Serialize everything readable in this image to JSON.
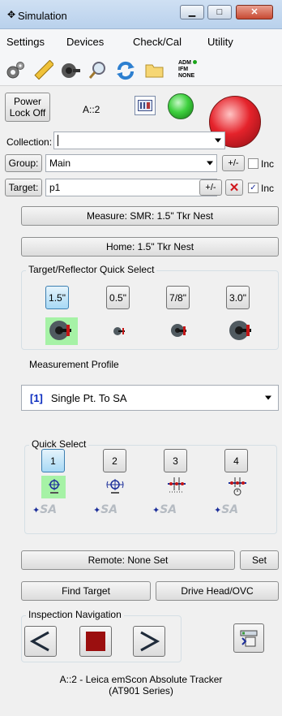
{
  "window": {
    "title": "Simulation",
    "minimize": "▭",
    "maximize": "▣",
    "close": "✕"
  },
  "menu": [
    "Settings",
    "Devices",
    "Check/Cal",
    "Utility"
  ],
  "toolbar": {
    "status_lines": [
      "ADM",
      "IFM",
      "NONE"
    ],
    "adm_dot_color": "#1aa51a"
  },
  "power": {
    "line1": "Power",
    "line2": "Lock Off"
  },
  "instrument_label": "A::2",
  "collection": {
    "label": "Collection:",
    "value": ""
  },
  "group": {
    "label": "Group:",
    "value": "Main",
    "pm": "+/-",
    "inc": "Inc",
    "inc_checked": false
  },
  "target": {
    "label": "Target:",
    "value": "p1",
    "pm": "+/-",
    "inc": "Inc",
    "inc_checked": true
  },
  "measure_button": "Measure: SMR: 1.5\" Tkr Nest",
  "home_button": "Home: 1.5\" Tkr Nest",
  "reflector": {
    "title": "Target/Reflector Quick Select",
    "buttons": [
      "1.5\"",
      "0.5\"",
      "7/8\"",
      "3.0\""
    ],
    "selected_index": 0
  },
  "profile": {
    "title": "Measurement Profile",
    "index": "[1]",
    "value": "Single Pt. To SA"
  },
  "quick_select": {
    "title": "Quick Select",
    "buttons": [
      "1",
      "2",
      "3",
      "4"
    ],
    "selected_index": 0
  },
  "remote": {
    "label": "Remote: None Set",
    "set": "Set"
  },
  "find_target": "Find Target",
  "drive_head": "Drive Head/OVC",
  "inspection": {
    "title": "Inspection Navigation"
  },
  "status": {
    "line1": "A::2 - Leica emScon Absolute Tracker",
    "line2": "(AT901 Series)"
  },
  "colors": {
    "green_led": "#3fd13f",
    "red_led": "#e5232b",
    "accent_blue": "#0a2bbf",
    "stop_red": "#9b0f0f"
  }
}
